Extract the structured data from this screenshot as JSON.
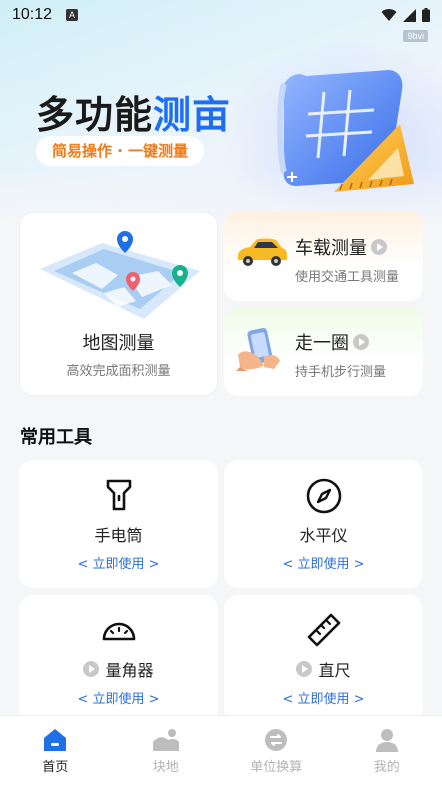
{
  "status_bar": {
    "time": "10:12",
    "notification_icon": "A",
    "icons": [
      "wifi-icon",
      "signal-icon",
      "battery-icon"
    ]
  },
  "tag": "9bvi",
  "banner": {
    "title_part1": "多功能",
    "title_part2": "测亩",
    "subtitle": "简易操作 · 一键测量"
  },
  "features": {
    "map": {
      "title": "地图测量",
      "subtitle": "高效完成面积测量"
    },
    "car": {
      "title": "车载测量",
      "subtitle": "使用交通工具测量"
    },
    "walk": {
      "title": "走一圈",
      "subtitle": "持手机步行测量"
    }
  },
  "tools_section": {
    "title": "常用工具"
  },
  "tools": [
    {
      "name": "手电筒",
      "link": "< 立即使用 >",
      "icon": "flashlight-icon"
    },
    {
      "name": "水平仪",
      "link": "< 立即使用 >",
      "icon": "compass-icon"
    },
    {
      "name": "量角器",
      "link": "< 立即使用 >",
      "icon": "protractor-icon"
    },
    {
      "name": "直尺",
      "link": "< 立即使用 >",
      "icon": "ruler-icon"
    }
  ],
  "bottom_nav": [
    {
      "label": "首页",
      "active": true,
      "icon": "home-icon"
    },
    {
      "label": "块地",
      "active": false,
      "icon": "land-icon"
    },
    {
      "label": "单位换算",
      "active": false,
      "icon": "convert-icon"
    },
    {
      "label": "我的",
      "active": false,
      "icon": "profile-icon"
    }
  ],
  "colors": {
    "accent": "#1e6ef5",
    "subtitle_orange": "#ef7b1a",
    "link_blue": "#2b6fdd"
  }
}
